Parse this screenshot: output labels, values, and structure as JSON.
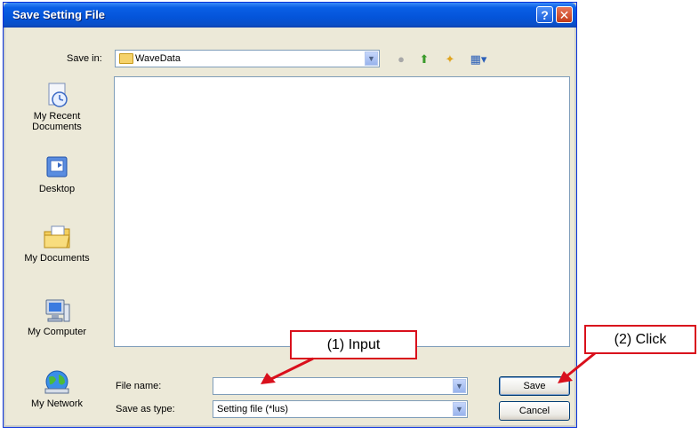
{
  "dialog": {
    "title": "Save Setting File",
    "help_symbol": "?",
    "close_symbol": "✕"
  },
  "save_in": {
    "label": "Save in:",
    "value": "WaveData"
  },
  "toolbar": {
    "icons": [
      "back-icon",
      "up-folder-icon",
      "new-folder-icon",
      "view-menu-icon"
    ]
  },
  "places": [
    {
      "label": "My Recent Documents",
      "icon": "recent-documents-icon"
    },
    {
      "label": "Desktop",
      "icon": "desktop-icon"
    },
    {
      "label": "My Documents",
      "icon": "my-documents-icon"
    },
    {
      "label": "My Computer",
      "icon": "my-computer-icon"
    },
    {
      "label": "My Network",
      "icon": "network-icon"
    }
  ],
  "file_name": {
    "label": "File name:",
    "value": ""
  },
  "save_as_type": {
    "label": "Save as type:",
    "value": "Setting file (*lus)"
  },
  "buttons": {
    "save": "Save",
    "cancel": "Cancel"
  },
  "annotations": {
    "input_callout": "(1) Input",
    "click_callout": "(2) Click",
    "accent_color": "#d9101c"
  }
}
